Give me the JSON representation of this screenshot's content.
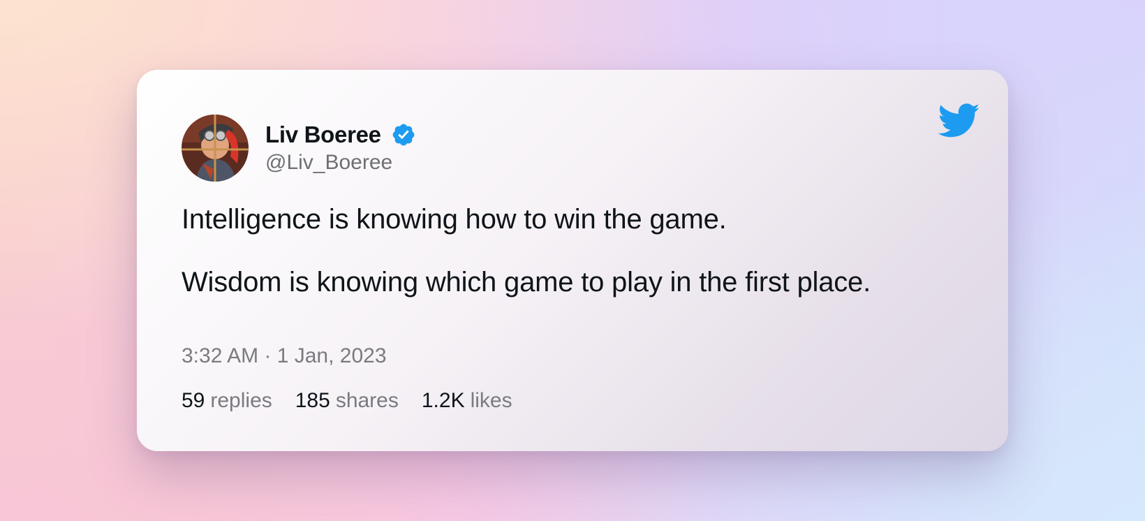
{
  "tweet": {
    "author": {
      "name": "Liv Boeree",
      "handle": "@Liv_Boeree",
      "verified": true,
      "avatar_icon": "profile-photo",
      "verified_icon": "verified-badge-icon"
    },
    "platform_icon": "twitter-bird-icon",
    "text": [
      "Intelligence is knowing how to win the game.",
      "Wisdom is knowing which game to play in the first place."
    ],
    "timestamp": "3:32 AM · 1 Jan, 2023",
    "stats": [
      {
        "count": "59",
        "label": "replies"
      },
      {
        "count": "185",
        "label": "shares"
      },
      {
        "count": "1.2K",
        "label": "likes"
      }
    ]
  },
  "colors": {
    "twitter_blue": "#1d9bf0",
    "text_primary": "#0f1419",
    "text_secondary": "#7a7a80"
  }
}
